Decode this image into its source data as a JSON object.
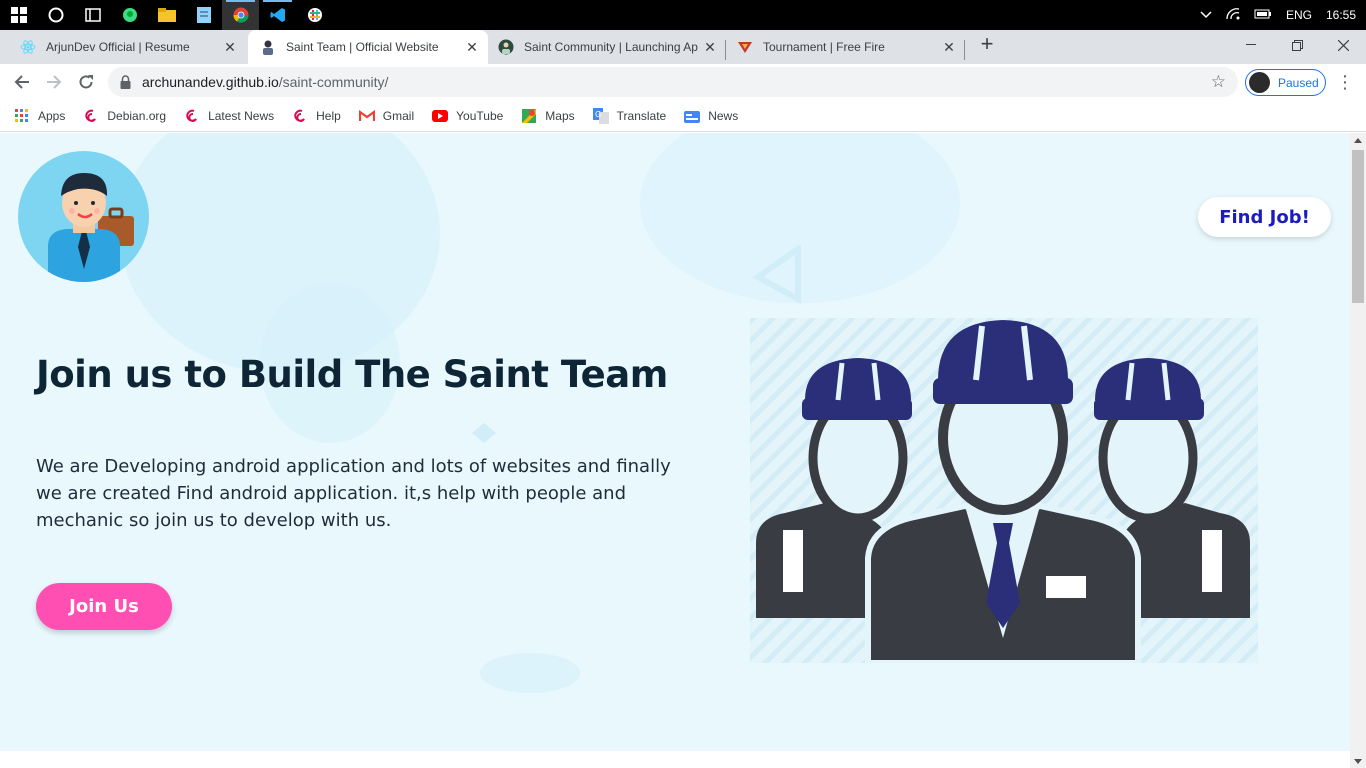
{
  "taskbar": {
    "language": "ENG",
    "time": "16:55"
  },
  "tabs": [
    {
      "title": "ArjunDev Official | Resume",
      "icon": "react-icon"
    },
    {
      "title": "Saint Team | Official Website",
      "icon": "saint-team-icon",
      "active": true
    },
    {
      "title": "Saint Community | Launching Ap",
      "icon": "saint-community-icon"
    },
    {
      "title": "Tournament | Free Fire",
      "icon": "free-fire-icon"
    }
  ],
  "address_bar": {
    "host": "archunandev.github.io",
    "path": "/saint-community/"
  },
  "profile": {
    "label": "Paused"
  },
  "bookmarks": [
    {
      "label": "Apps",
      "icon": "apps-grid-icon"
    },
    {
      "label": "Debian.org",
      "icon": "debian-icon"
    },
    {
      "label": "Latest News",
      "icon": "debian-icon"
    },
    {
      "label": "Help",
      "icon": "debian-icon"
    },
    {
      "label": "Gmail",
      "icon": "gmail-icon"
    },
    {
      "label": "YouTube",
      "icon": "youtube-icon"
    },
    {
      "label": "Maps",
      "icon": "maps-icon"
    },
    {
      "label": "Translate",
      "icon": "translate-icon"
    },
    {
      "label": "News",
      "icon": "news-icon"
    }
  ],
  "page": {
    "find_job_label": "Find Job!",
    "title": "Join us to Build The Saint Team",
    "description": "We are Developing android application and lots of websites and finally we are created Find android application. it,s help with people and mechanic so join us to develop with us.",
    "join_label": "Join Us"
  },
  "colors": {
    "hero_bg": "#e8f8fd",
    "join_button": "#ff4fb2",
    "find_job_text": "#1b1bc4",
    "helmet_blue": "#2b2f7a",
    "suit_dark": "#3a3c44"
  }
}
